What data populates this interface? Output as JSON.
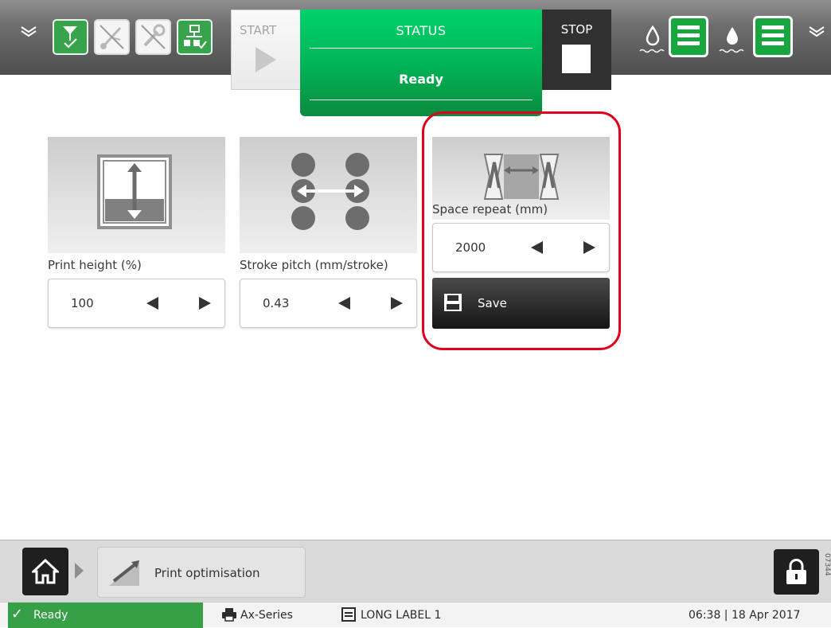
{
  "header": {
    "indicators": [
      {
        "icon": "printer-ready-icon",
        "state": "green"
      },
      {
        "icon": "usb-disabled-icon",
        "state": "white"
      },
      {
        "icon": "maintenance-disabled-icon",
        "state": "white"
      },
      {
        "icon": "network-connected-icon",
        "state": "green"
      }
    ],
    "start_label": "START",
    "status_title": "STATUS",
    "status_value": "Ready",
    "stop_label": "STOP",
    "ink_levels": [
      {
        "icon": "makeup-drop-icon",
        "level_icon": "level-full-icon"
      },
      {
        "icon": "ink-drop-icon",
        "level_icon": "level-full-icon"
      }
    ]
  },
  "params": [
    {
      "label": "Print height (%)",
      "value": "100"
    },
    {
      "label": "Stroke pitch (mm/stroke)",
      "value": "0.43"
    },
    {
      "label": "Space repeat (mm)",
      "value": "2000"
    }
  ],
  "save_label": "Save",
  "nav": {
    "breadcrumb": "Print optimisation",
    "side_code": "07344"
  },
  "statusbar": {
    "ready": "Ready",
    "printer": "Ax-Series",
    "job": "LONG LABEL 1",
    "datetime": "06:38 | 18 Apr 2017"
  },
  "colors": {
    "status_green": "#00c463",
    "ready_green": "#35a045",
    "indicator_green": "#37a34a",
    "highlight_red": "#e0001b",
    "dark_button": "#2d2d2d"
  }
}
